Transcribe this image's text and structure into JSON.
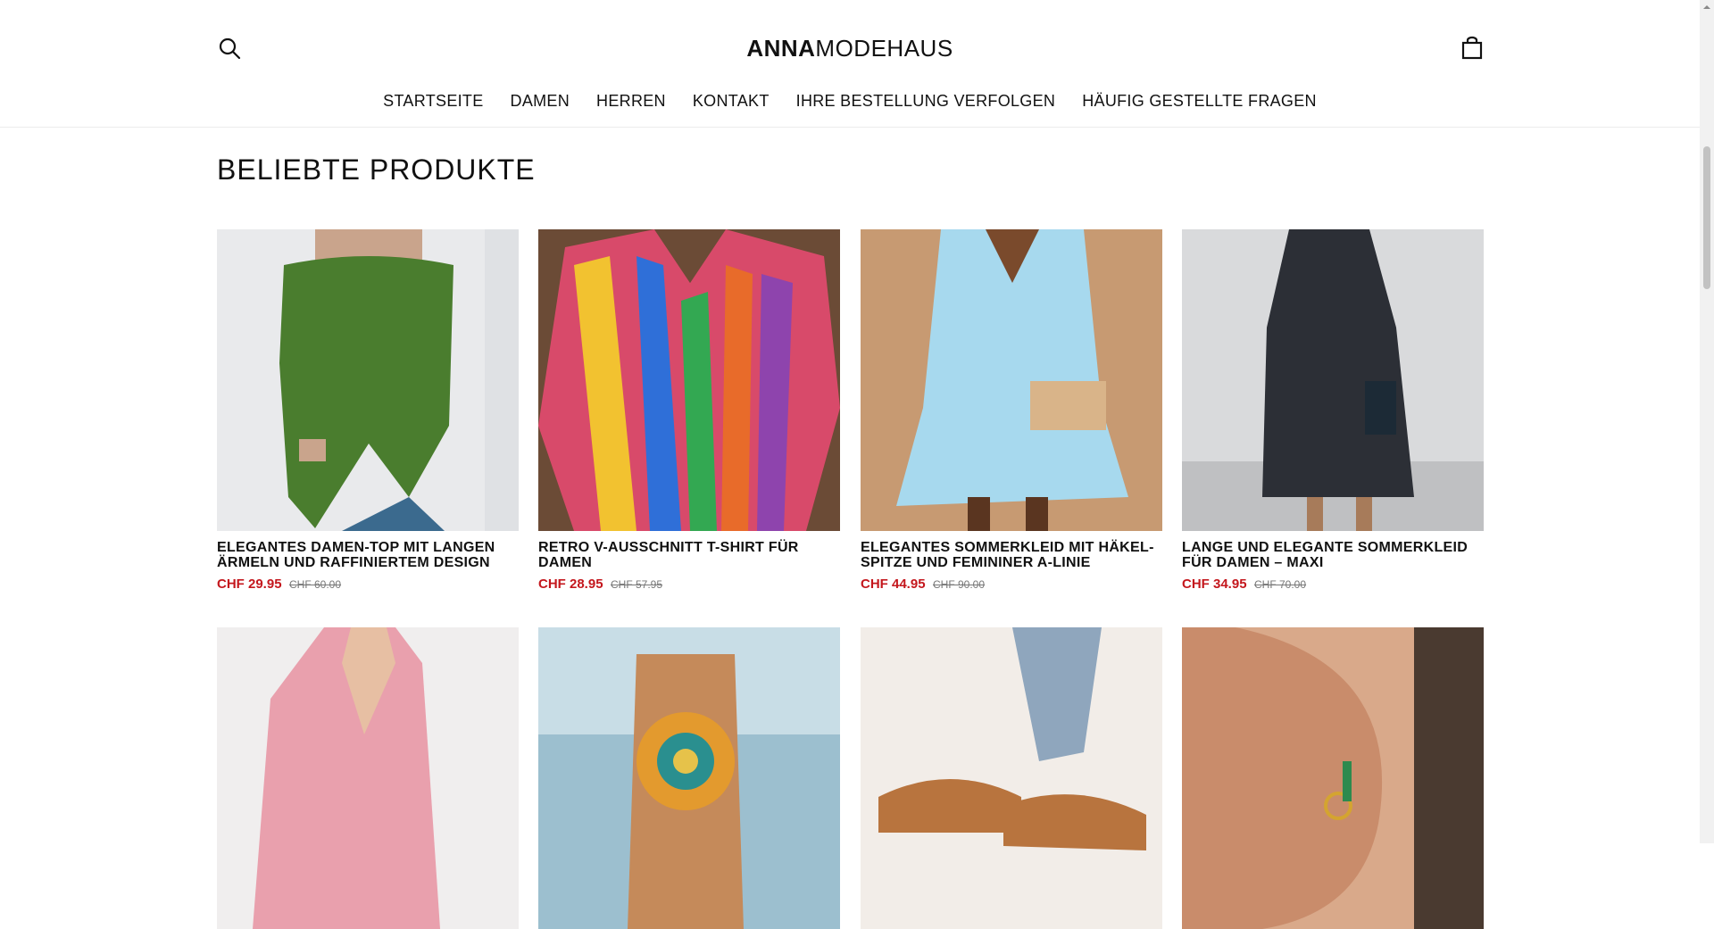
{
  "header": {
    "logo_bold": "ANNA",
    "logo_light": "MODEHAUS",
    "search_icon": "search-icon",
    "cart_icon": "shopping-bag-icon"
  },
  "nav": {
    "items": [
      "STARTSEITE",
      "DAMEN",
      "HERREN",
      "KONTAKT",
      "IHRE BESTELLUNG VERFOLGEN",
      "HÄUFIG GESTELLTE FRAGEN"
    ]
  },
  "section": {
    "title": "BELIEBTE PRODUKTE"
  },
  "products": [
    {
      "name": "ELEGANTES DAMEN-TOP MIT LANGEN ÄRMELN UND RAFFINIERTEM DESIGN",
      "price": "CHF 29.95",
      "old_price": "CHF 60.00"
    },
    {
      "name": "RETRO V-AUSSCHNITT T-SHIRT FÜR DAMEN",
      "price": "CHF 28.95",
      "old_price": "CHF 57.95"
    },
    {
      "name": "ELEGANTES SOMMERKLEID MIT HÄKEL-SPITZE UND FEMININER A-LINIE",
      "price": "CHF 44.95",
      "old_price": "CHF 90.00"
    },
    {
      "name": "LANGE UND ELEGANTE SOMMERKLEID FÜR DAMEN – MAXI",
      "price": "CHF 34.95",
      "old_price": "CHF 70.00"
    }
  ],
  "colors": {
    "sale_price": "#c4171d",
    "text": "#111111"
  }
}
